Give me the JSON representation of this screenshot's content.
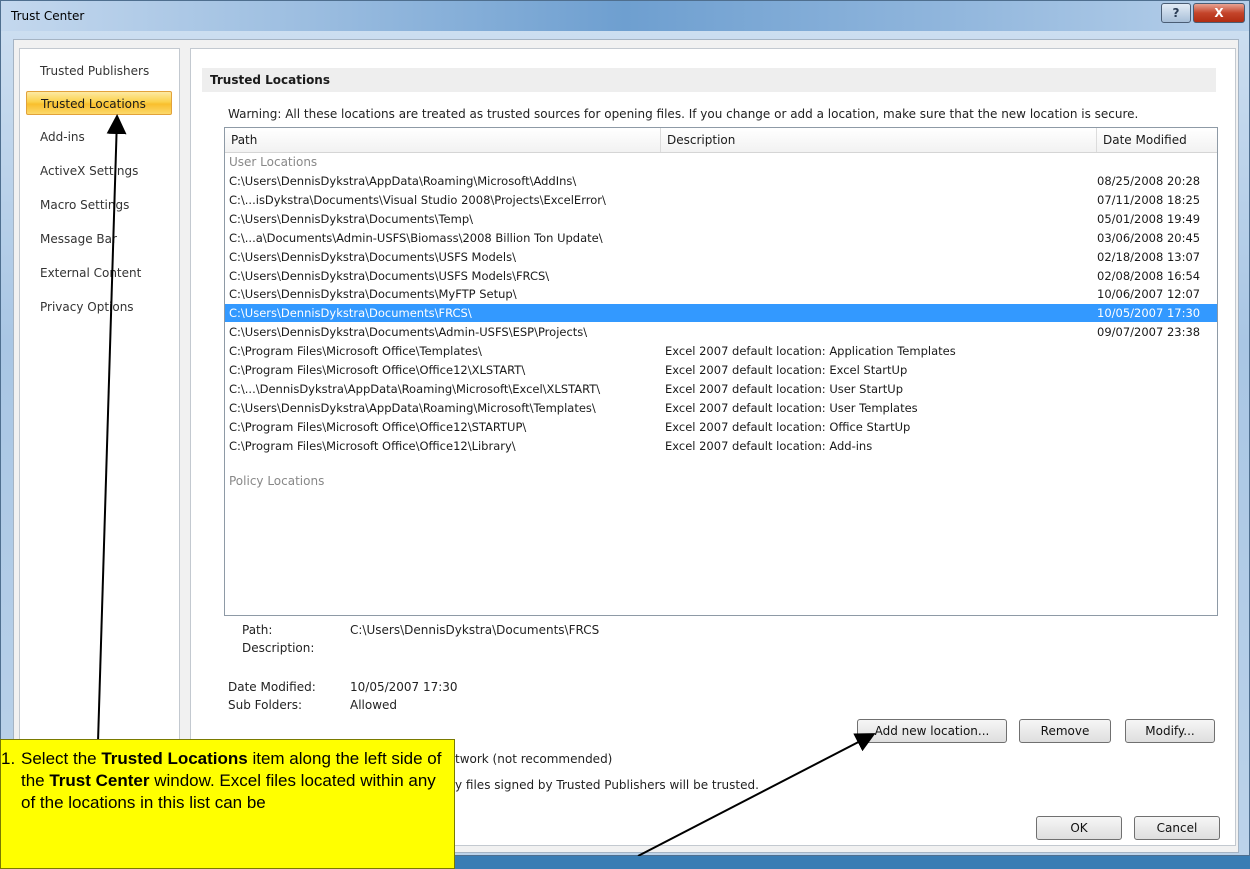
{
  "window": {
    "title": "Trust Center",
    "help_label": "?",
    "close_label": "X"
  },
  "sidebar": {
    "items": [
      {
        "label": "Trusted Publishers"
      },
      {
        "label": "Trusted Locations"
      },
      {
        "label": "Add-ins"
      },
      {
        "label": "ActiveX Settings"
      },
      {
        "label": "Macro Settings"
      },
      {
        "label": "Message Bar"
      },
      {
        "label": "External Content"
      },
      {
        "label": "Privacy Options"
      }
    ],
    "active_index": 1
  },
  "main": {
    "section_title": "Trusted Locations",
    "warning": "Warning: All these locations are treated as trusted sources for opening files.  If you change or add a location, make sure that the new location is secure.",
    "columns": {
      "path": "Path",
      "description": "Description",
      "date": "Date Modified"
    },
    "user_group_label": "User Locations",
    "policy_group_label": "Policy Locations",
    "rows": [
      {
        "path": "C:\\Users\\DennisDykstra\\AppData\\Roaming\\Microsoft\\AddIns\\",
        "description": "",
        "date": "08/25/2008 20:28"
      },
      {
        "path": "C:\\...isDykstra\\Documents\\Visual Studio 2008\\Projects\\ExcelError\\",
        "description": "",
        "date": "07/11/2008 18:25"
      },
      {
        "path": "C:\\Users\\DennisDykstra\\Documents\\Temp\\",
        "description": "",
        "date": "05/01/2008 19:49"
      },
      {
        "path": "C:\\...a\\Documents\\Admin-USFS\\Biomass\\2008 Billion Ton Update\\",
        "description": "",
        "date": "03/06/2008 20:45"
      },
      {
        "path": "C:\\Users\\DennisDykstra\\Documents\\USFS Models\\",
        "description": "",
        "date": "02/18/2008 13:07"
      },
      {
        "path": "C:\\Users\\DennisDykstra\\Documents\\USFS Models\\FRCS\\",
        "description": "",
        "date": "02/08/2008 16:54"
      },
      {
        "path": "C:\\Users\\DennisDykstra\\Documents\\MyFTP Setup\\",
        "description": "",
        "date": "10/06/2007 12:07"
      },
      {
        "path": "C:\\Users\\DennisDykstra\\Documents\\FRCS\\",
        "description": "",
        "date": "10/05/2007 17:30",
        "selected": true
      },
      {
        "path": "C:\\Users\\DennisDykstra\\Documents\\Admin-USFS\\ESP\\Projects\\",
        "description": "",
        "date": "09/07/2007 23:38"
      },
      {
        "path": "C:\\Program Files\\Microsoft Office\\Templates\\",
        "description": "Excel 2007 default location: Application Templates",
        "date": ""
      },
      {
        "path": "C:\\Program Files\\Microsoft Office\\Office12\\XLSTART\\",
        "description": "Excel 2007 default location: Excel StartUp",
        "date": ""
      },
      {
        "path": "C:\\...\\DennisDykstra\\AppData\\Roaming\\Microsoft\\Excel\\XLSTART\\",
        "description": "Excel 2007 default location: User StartUp",
        "date": ""
      },
      {
        "path": "C:\\Users\\DennisDykstra\\AppData\\Roaming\\Microsoft\\Templates\\",
        "description": "Excel 2007 default location: User Templates",
        "date": ""
      },
      {
        "path": "C:\\Program Files\\Microsoft Office\\Office12\\STARTUP\\",
        "description": "Excel 2007 default location: Office StartUp",
        "date": ""
      },
      {
        "path": "C:\\Program Files\\Microsoft Office\\Office12\\Library\\",
        "description": "Excel 2007 default location: Add-ins",
        "date": ""
      }
    ],
    "details": {
      "path_label": "Path:",
      "path_value": "C:\\Users\\DennisDykstra\\Documents\\FRCS",
      "description_label": "Description:",
      "date_label": "Date Modified:",
      "date_value": "10/05/2007 17:30",
      "subfolders_label": "Sub Folders:",
      "subfolders_value": "Allowed"
    },
    "buttons": {
      "add": "Add new location...",
      "remove": "Remove",
      "modify": "Modify..."
    },
    "network_text": "twork (not recommended)",
    "publishers_text": "y files signed by Trusted Publishers will be trusted.",
    "ok": "OK",
    "cancel": "Cancel"
  },
  "callout": {
    "number": "1.",
    "p1": "Select the ",
    "b1": "Trusted Locations",
    "p2": " item along the left side of the ",
    "b2": "Trust Center",
    "p3": " window. Excel files located within any of the locations in this list can be"
  }
}
